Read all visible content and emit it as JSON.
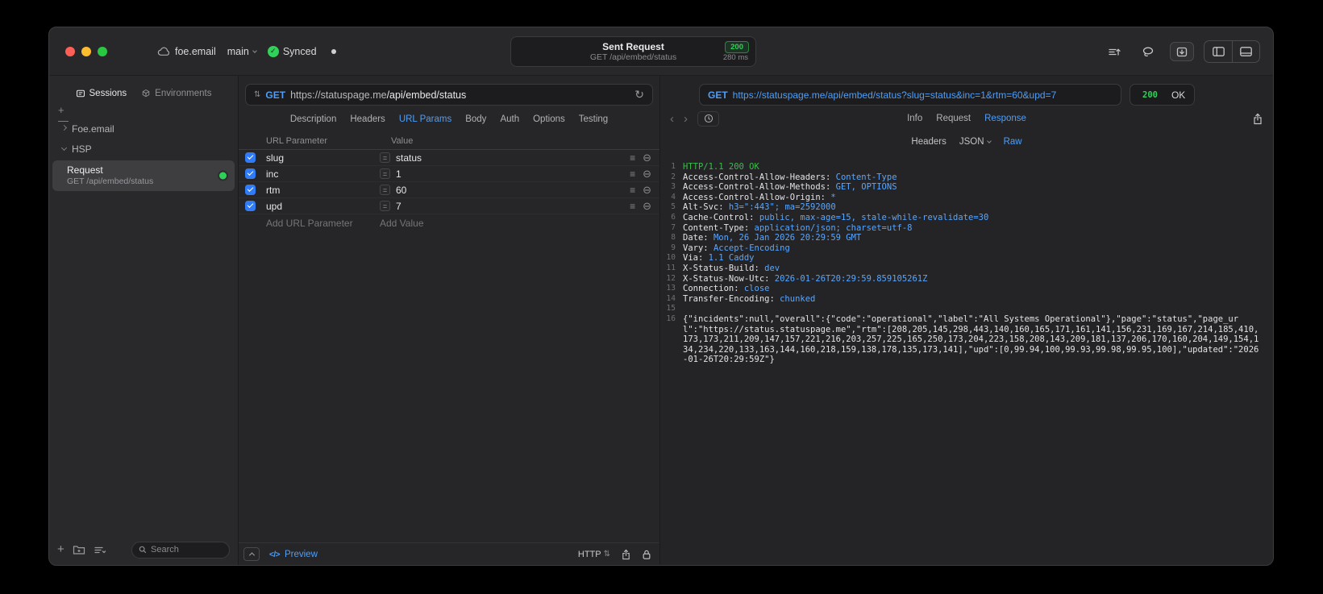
{
  "titlebar": {
    "project": "foe.email",
    "branch": "main",
    "sync_label": "Synced",
    "request_title": "Sent Request",
    "request_subtitle": "GET /api/embed/status",
    "status_badge": "200",
    "duration": "280 ms"
  },
  "colors": {
    "accent_blue": "#4f9ef7",
    "success_green": "#30d158",
    "status_line_green": "#3fb950",
    "header_value_blue": "#58a6ff"
  },
  "sidebar": {
    "tabs": [
      {
        "label": "Sessions",
        "active": true
      },
      {
        "label": "Environments",
        "active": false
      }
    ],
    "tree": [
      {
        "label": "Foe.email",
        "expanded": false
      },
      {
        "label": "HSP",
        "expanded": true
      }
    ],
    "request_item": {
      "title": "Request",
      "subtitle": "GET /api/embed/status"
    },
    "search_placeholder": "Search"
  },
  "request_editor": {
    "method": "GET",
    "url_host": "https://statuspage.me",
    "url_path": "/api/embed/status",
    "tabs": [
      "Description",
      "Headers",
      "URL Params",
      "Body",
      "Auth",
      "Options",
      "Testing"
    ],
    "active_tab": "URL Params",
    "params_table": {
      "columns": [
        "URL Parameter",
        "Value"
      ],
      "rows": [
        {
          "key": "slug",
          "value": "status",
          "checked": true
        },
        {
          "key": "inc",
          "value": "1",
          "checked": true
        },
        {
          "key": "rtm",
          "value": "60",
          "checked": true
        },
        {
          "key": "upd",
          "value": "7",
          "checked": true
        }
      ],
      "add_key_placeholder": "Add URL Parameter",
      "add_value_placeholder": "Add Value"
    },
    "footer": {
      "preview_label": "Preview",
      "protocol_label": "HTTP"
    }
  },
  "response_viewer": {
    "method": "GET",
    "url": "https://statuspage.me/api/embed/status?slug=status&inc=1&rtm=60&upd=7",
    "status_code": "200",
    "status_text": "OK",
    "tabs": [
      "Info",
      "Request",
      "Response"
    ],
    "active_tab": "Response",
    "subtabs": [
      "Headers",
      "JSON",
      "Raw"
    ],
    "active_subtab": "Raw",
    "raw_lines": [
      {
        "num": "1",
        "status": "HTTP/1.1 200 OK"
      },
      {
        "num": "2",
        "name": "Access-Control-Allow-Headers: ",
        "value": "Content-Type"
      },
      {
        "num": "3",
        "name": "Access-Control-Allow-Methods: ",
        "value": "GET, OPTIONS"
      },
      {
        "num": "4",
        "name": "Access-Control-Allow-Origin: ",
        "value": "*"
      },
      {
        "num": "5",
        "name": "Alt-Svc: ",
        "value": "h3=\":443\"; ma=2592000"
      },
      {
        "num": "6",
        "name": "Cache-Control: ",
        "value": "public, max-age=15, stale-while-revalidate=30"
      },
      {
        "num": "7",
        "name": "Content-Type: ",
        "value": "application/json; charset=utf-8"
      },
      {
        "num": "8",
        "name": "Date: ",
        "value": "Mon, 26 Jan 2026 20:29:59 GMT"
      },
      {
        "num": "9",
        "name": "Vary: ",
        "value": "Accept-Encoding"
      },
      {
        "num": "10",
        "name": "Via: ",
        "value": "1.1 Caddy"
      },
      {
        "num": "11",
        "name": "X-Status-Build: ",
        "value": "dev"
      },
      {
        "num": "12",
        "name": "X-Status-Now-Utc: ",
        "value": "2026-01-26T20:29:59.859105261Z"
      },
      {
        "num": "13",
        "name": "Connection: ",
        "value": "close"
      },
      {
        "num": "14",
        "name": "Transfer-Encoding: ",
        "value": "chunked"
      },
      {
        "num": "15"
      },
      {
        "num": "16",
        "body": "{\"incidents\":null,\"overall\":{\"code\":\"operational\",\"label\":\"All Systems Operational\"},\"page\":\"status\",\"page_url\":\"https://status.statuspage.me\",\"rtm\":[208,205,145,298,443,140,160,165,171,161,141,156,231,169,167,214,185,410,173,173,211,209,147,157,221,216,203,257,225,165,250,173,204,223,158,208,143,209,181,137,206,170,160,204,149,154,134,234,220,133,163,144,160,218,159,138,178,135,173,141],\"upd\":[0,99.94,100,99.93,99.98,99.95,100],\"updated\":\"2026-01-26T20:29:59Z\"}"
      }
    ]
  }
}
